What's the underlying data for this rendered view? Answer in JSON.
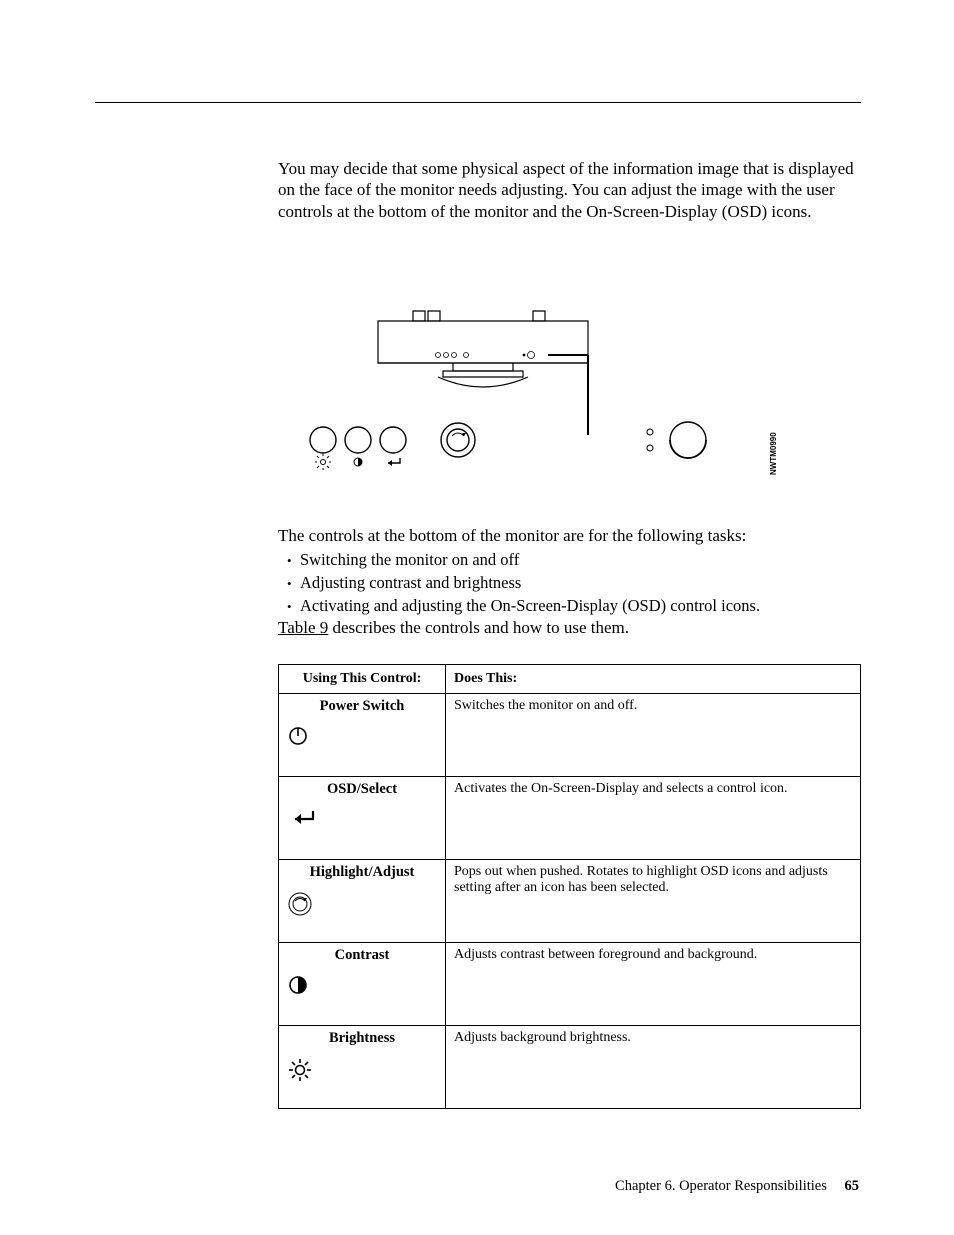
{
  "intro_text": "You may decide that some physical aspect of the information image that is displayed on the face of the monitor needs adjusting. You can adjust the image with the user controls at the bottom of the monitor and the On-Screen-Display (OSD) icons.",
  "figure_id": "NWTM0990",
  "controls_para": "The controls at the bottom of the monitor are for the following tasks:",
  "bullets": [
    "Switching the monitor on and off",
    "Adjusting contrast and brightness",
    "Activating and adjusting the On-Screen-Display (OSD) control icons."
  ],
  "table_ref_link": "Table 9",
  "table_ref_rest": " describes the controls and how to use them.",
  "table": {
    "headers": [
      "Using This Control:",
      "Does This:"
    ],
    "rows": [
      {
        "label": "Power Switch",
        "desc": "Switches the monitor on and off."
      },
      {
        "label": "OSD/Select",
        "desc": "Activates the On-Screen-Display and selects a control icon."
      },
      {
        "label": "Highlight/Adjust",
        "desc": "Pops out when pushed. Rotates to highlight OSD icons and adjusts setting after an icon has been selected."
      },
      {
        "label": "Contrast",
        "desc": "Adjusts contrast between foreground and background."
      },
      {
        "label": "Brightness",
        "desc": "Adjusts background brightness."
      }
    ]
  },
  "footer_chapter": "Chapter 6. Operator Responsibilities",
  "footer_page": "65"
}
